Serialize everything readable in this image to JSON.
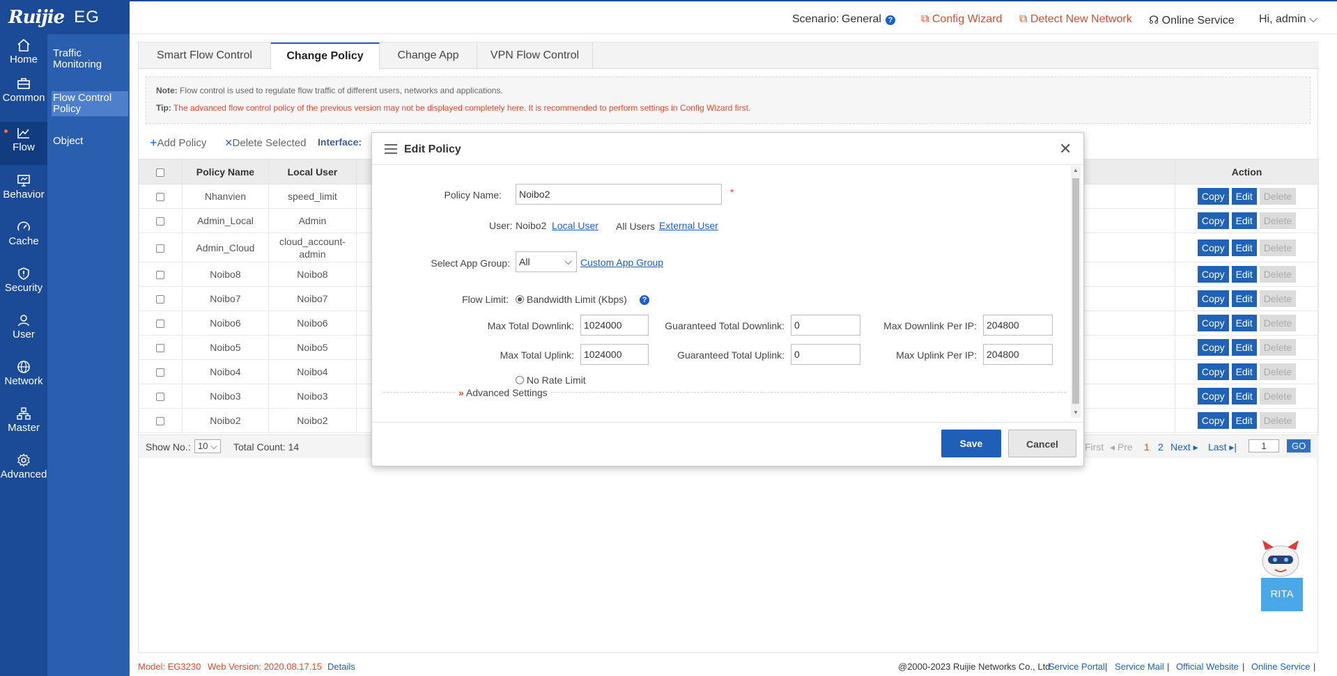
{
  "brand": {
    "logo": "Ruijie",
    "product": "EG"
  },
  "rail": [
    {
      "label": "Home",
      "icon": "home-icon"
    },
    {
      "label": "Common",
      "icon": "briefcase-icon"
    },
    {
      "label": "Flow",
      "icon": "chart-line-icon"
    },
    {
      "label": "Behavior",
      "icon": "monitor-icon"
    },
    {
      "label": "Cache",
      "icon": "gauge-icon"
    },
    {
      "label": "Security",
      "icon": "shield-icon"
    },
    {
      "label": "User",
      "icon": "user-icon"
    },
    {
      "label": "Network",
      "icon": "globe-icon"
    },
    {
      "label": "Master",
      "icon": "hierarchy-icon"
    },
    {
      "label": "Advanced",
      "icon": "gear-icon"
    }
  ],
  "subnav": [
    {
      "label": "Traffic Monitoring"
    },
    {
      "label": "Flow Control Policy"
    },
    {
      "label": "Object"
    }
  ],
  "header": {
    "scenario_label": "Scenario:",
    "scenario_value": "General",
    "help": "?",
    "config_wizard": "Config Wizard",
    "detect_network": "Detect New Network",
    "online_service": "Online Service",
    "greeting": "Hi, admin"
  },
  "tabs": [
    {
      "label": "Smart Flow Control"
    },
    {
      "label": "Change Policy"
    },
    {
      "label": "Change App"
    },
    {
      "label": "VPN Flow Control"
    }
  ],
  "notes": {
    "note_label": "Note:",
    "note_text": "Flow control is used to regulate flow traffic of different users, networks and applications.",
    "tip_label": "Tip:",
    "tip_text": "The advanced flow control policy of the previous version may not be displayed completely here. It is recommended to perform settings in Config Wizard first."
  },
  "toolbar": {
    "add_policy": "Add Policy",
    "delete_selected": "Delete Selected",
    "interface_label": "Interface:"
  },
  "table": {
    "headers": {
      "policy_name": "Policy Name",
      "local_user": "Local User",
      "action": "Action"
    },
    "rows": [
      {
        "policy": "Nhanvien",
        "user": "speed_limit"
      },
      {
        "policy": "Admin_Local",
        "user": "Admin"
      },
      {
        "policy": "Admin_Cloud",
        "user": "cloud_account-admin"
      },
      {
        "policy": "Noibo8",
        "user": "Noibo8"
      },
      {
        "policy": "Noibo7",
        "user": "Noibo7"
      },
      {
        "policy": "Noibo6",
        "user": "Noibo6"
      },
      {
        "policy": "Noibo5",
        "user": "Noibo5"
      },
      {
        "policy": "Noibo4",
        "user": "Noibo4"
      },
      {
        "policy": "Noibo3",
        "user": "Noibo3"
      },
      {
        "policy": "Noibo2",
        "user": "Noibo2"
      }
    ],
    "actions": {
      "copy": "Copy",
      "edit": "Edit",
      "delete": "Delete"
    }
  },
  "pagination": {
    "show_no_label": "Show No.:",
    "show_no_value": "10",
    "total_count": "Total Count: 14",
    "first": "First",
    "pre": "Pre",
    "page1": "1",
    "page2": "2",
    "next": "Next",
    "last": "Last",
    "goto_value": "1",
    "go": "GO"
  },
  "status_bar": {
    "model": "Model:  EG3230",
    "web_version": "Web Version:  2020.08.17.15",
    "details": "Details",
    "copyright": "@2000-2023 Ruijie Networks Co., Ltd",
    "service_portal": "Service Portal",
    "service_mail": "Service Mail",
    "official_website": "Official Website",
    "online_service": "Online Service",
    "sep": "|"
  },
  "rita": {
    "label": "RITA"
  },
  "modal": {
    "title": "Edit Policy",
    "policy_name_label": "Policy Name:",
    "policy_name_value": "Noibo2",
    "required": "*",
    "user_label": "User:",
    "user_value": "Noibo2",
    "local_user": "Local User",
    "all_users": "All Users",
    "external_user": "External User",
    "app_group_label": "Select App Group:",
    "app_group_value": "All",
    "custom_app_group": "Custom App Group",
    "flow_limit_label": "Flow Limit:",
    "bandwidth_limit": "Bandwidth Limit (Kbps)",
    "bandwidth_selected": true,
    "max_total_downlink_label": "Max Total Downlink:",
    "max_total_downlink": "1024000",
    "guaranteed_total_downlink_label": "Guaranteed Total Downlink:",
    "guaranteed_total_downlink": "0",
    "max_downlink_per_ip_label": "Max Downlink Per IP:",
    "max_downlink_per_ip": "204800",
    "max_total_uplink_label": "Max Total Uplink:",
    "max_total_uplink": "1024000",
    "guaranteed_total_uplink_label": "Guaranteed Total Uplink:",
    "guaranteed_total_uplink": "0",
    "max_uplink_per_ip_label": "Max Uplink Per IP:",
    "max_uplink_per_ip": "204800",
    "no_rate_limit": "No Rate Limit",
    "advanced_settings": "Advanced Settings",
    "save": "Save",
    "cancel": "Cancel"
  },
  "colors": {
    "rail": "#1b4b97",
    "subnav": "#2a5fb0",
    "accent": "#1f62b8",
    "warn": "#e8472b"
  }
}
